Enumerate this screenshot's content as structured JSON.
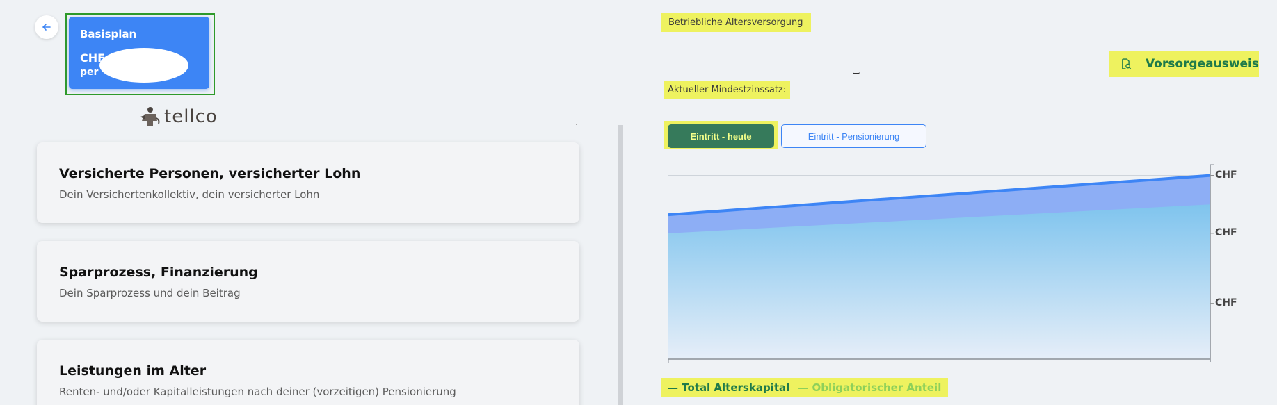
{
  "plan": {
    "title": "Basisplan",
    "amount": "CHF",
    "per": "per"
  },
  "logo": {
    "text": "tellco"
  },
  "cards": [
    {
      "title": "Versicherte Personen, versicherter Lohn",
      "subtitle": "Dein Versichertenkollektiv, dein versicherter Lohn"
    },
    {
      "title": "Sparprozess, Finanzierung",
      "subtitle": "Dein Sparprozess und dein Beitrag"
    },
    {
      "title": "Leistungen im Alter",
      "subtitle": "Renten- und/oder Kapitalleistungen nach deiner (vorzeitigen) Pensionierung"
    }
  ],
  "section": {
    "title": "Betriebliche Altersversorgung",
    "min_rate_label": "Aktueller Mindestzinssatz:",
    "vorsorge_button": "Vorsorgeausweis"
  },
  "toggle": {
    "active": "Eintritt - heute",
    "inactive": "Eintritt - Pensionierung"
  },
  "chart_data": {
    "type": "area",
    "x": [
      0,
      1
    ],
    "series": [
      {
        "name": "Total Alterskapital",
        "values": [
          0.7,
          0.89
        ],
        "color": "#3d85f5"
      },
      {
        "name": "Obligatorischer Anteil",
        "values": [
          0.61,
          0.75
        ],
        "color": "#8fd0f0"
      }
    ],
    "ytick_labels": [
      "CHF",
      "CHF",
      "CHF"
    ],
    "ylim": [
      0,
      1
    ],
    "grid": true
  },
  "legend": {
    "total": "— Total Alterskapital",
    "obligatorisch": "— Obligatorischer Anteil"
  },
  "colors": {
    "brand_blue": "#3d85f5",
    "brand_green": "#367a5b",
    "highlight": "#eef25f"
  }
}
